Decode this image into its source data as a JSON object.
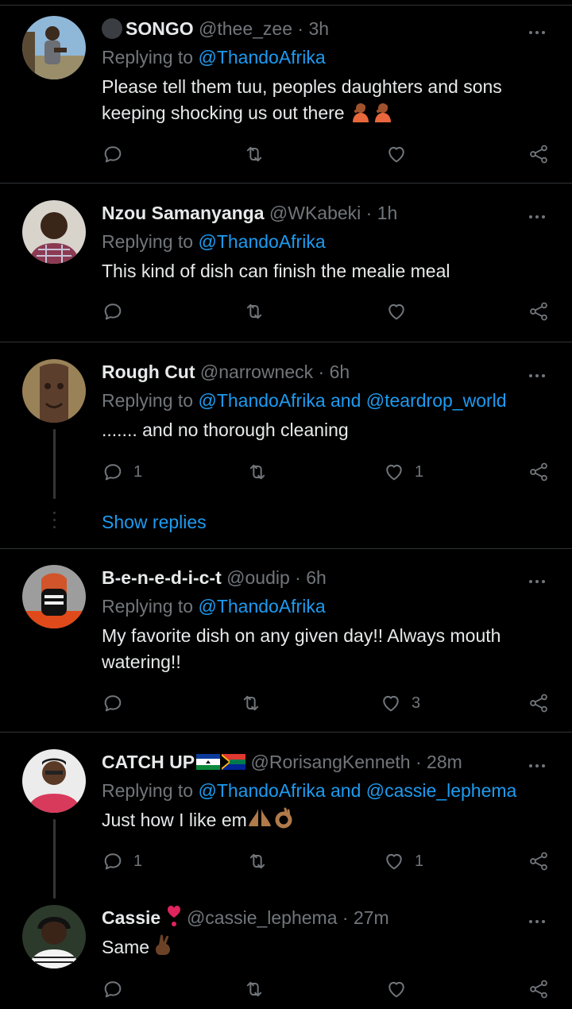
{
  "colors": {
    "background": "#000000",
    "text": "#e7e9ea",
    "muted": "#71767b",
    "link": "#1d9bf0",
    "divider": "#2f3336"
  },
  "tweets": [
    {
      "name": "SONGO",
      "handle": "@thee_zee",
      "time": "· 3h",
      "replying_prefix": "Replying to ",
      "mentions": [
        "@ThandoAfrika"
      ],
      "text_lines": [
        "Please tell them tuu, peoples daughters and sons",
        "keeping shocking us out there"
      ],
      "reply_count": "",
      "like_count": ""
    },
    {
      "name": "Nzou Samanyanga",
      "handle": "@WKabeki",
      "time": "· 1h",
      "replying_prefix": "Replying to ",
      "mentions": [
        "@ThandoAfrika"
      ],
      "text_lines": [
        "This kind of dish can finish the mealie meal"
      ],
      "reply_count": "",
      "like_count": ""
    },
    {
      "name": "Rough Cut",
      "handle": "@narrowneck",
      "time": "· 6h",
      "replying_prefix": "Replying to ",
      "mentions": [
        "@ThandoAfrika",
        "@teardrop_world"
      ],
      "and": " and ",
      "text_lines": [
        "....... and no thorough cleaning"
      ],
      "reply_count": "1",
      "like_count": "1"
    },
    {
      "name": "B-e-n-e-d-i-c-t",
      "handle": "@oudip",
      "time": "· 6h",
      "replying_prefix": "Replying to ",
      "mentions": [
        "@ThandoAfrika"
      ],
      "text_lines": [
        "My favorite dish on any given day!! Always mouth",
        "watering!!"
      ],
      "reply_count": "",
      "like_count": "3"
    },
    {
      "name": "CATCH UP",
      "handle": "@RorisangKenneth",
      "time": "· 28m",
      "replying_prefix": "Replying to ",
      "mentions": [
        "@ThandoAfrika",
        "@cassie_lephema"
      ],
      "and": " and ",
      "text_lines": [
        "Just how I like em"
      ],
      "reply_count": "1",
      "like_count": "1"
    },
    {
      "name": "Cassie",
      "handle": "@cassie_lephema",
      "time": "· 27m",
      "text_lines": [
        "Same"
      ],
      "reply_count": "",
      "like_count": ""
    }
  ],
  "show_replies_label": "Show replies",
  "icons": [
    "more-icon",
    "reply-icon",
    "retweet-icon",
    "like-icon",
    "share-icon"
  ]
}
